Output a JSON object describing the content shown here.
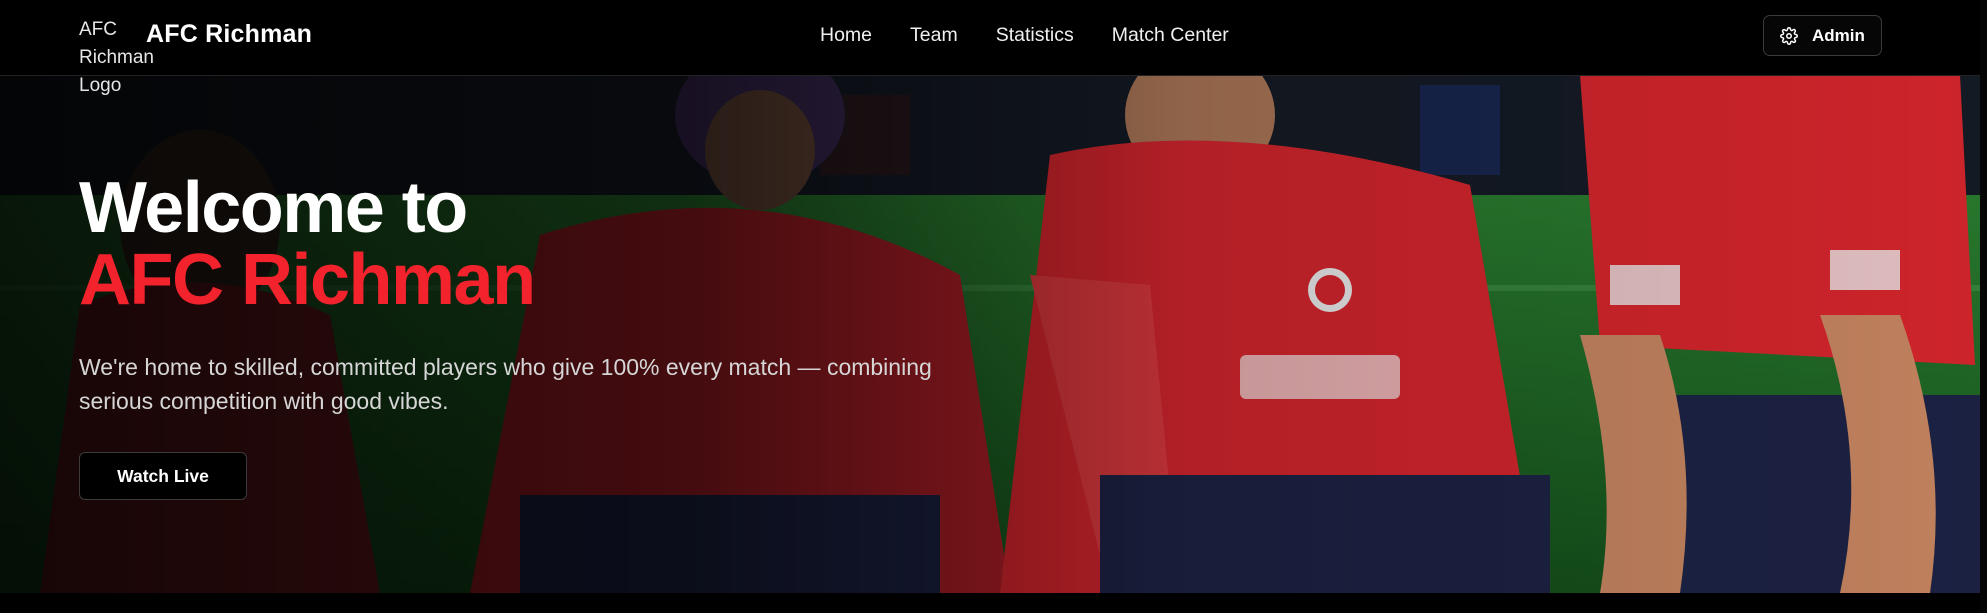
{
  "header": {
    "logo_alt": "AFC Richman Logo",
    "brand": "AFC Richman",
    "nav": [
      {
        "label": "Home"
      },
      {
        "label": "Team"
      },
      {
        "label": "Statistics"
      },
      {
        "label": "Match Center"
      }
    ],
    "admin_label": "Admin",
    "admin_icon": "gear-icon"
  },
  "hero": {
    "title_line1": "Welcome to",
    "title_line2": "AFC Richman",
    "subtitle": "We're home to skilled, committed players who give 100% every match — combining serious competition with good vibes.",
    "cta_label": "Watch Live"
  },
  "colors": {
    "accent_red": "#f2232c",
    "background": "#000000",
    "pitch_green": "#1f7a2a",
    "jersey_red": "#d9262e",
    "shorts_navy": "#1d2346"
  }
}
